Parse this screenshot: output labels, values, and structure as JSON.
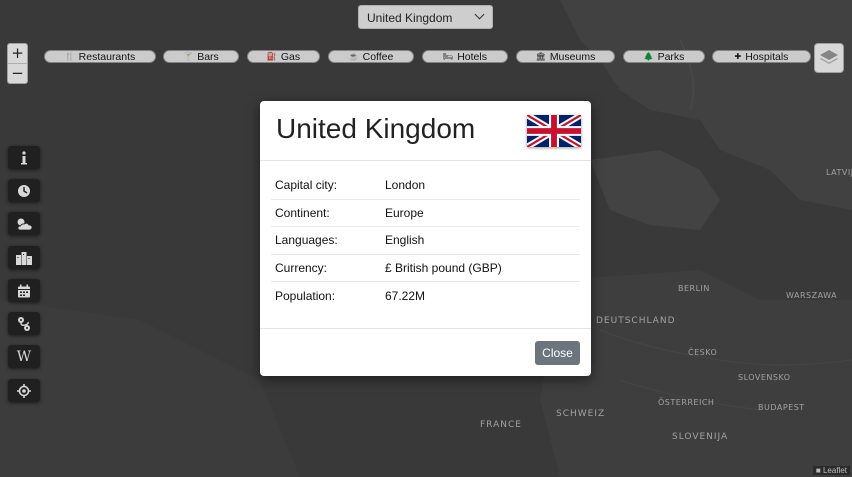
{
  "country_select": {
    "selected": "United Kingdom"
  },
  "zoom": {
    "in": "+",
    "out": "−"
  },
  "categories": [
    {
      "icon": "🍴",
      "label": "Restaurants"
    },
    {
      "icon": "🍸",
      "label": "Bars"
    },
    {
      "icon": "⛽",
      "label": "Gas"
    },
    {
      "icon": "☕",
      "label": "Coffee"
    },
    {
      "icon": "🛏",
      "label": "Hotels"
    },
    {
      "icon": "🏛",
      "label": "Museums"
    },
    {
      "icon": "🌲",
      "label": "Parks"
    },
    {
      "icon": "✚",
      "label": "Hospitals"
    }
  ],
  "map_labels": [
    "BERLIN",
    "WARSZAWA",
    "DEUTSCHLAND",
    "FRANCE",
    "SCHWEIZ",
    "SLOVENSKO",
    "BUDAPEST",
    "ÖSTERREICH",
    "SLOVENIJA",
    "ČESKO",
    "LATVIJA"
  ],
  "modal": {
    "title": "United Kingdom",
    "rows": [
      {
        "key": "Capital city:",
        "value": "London"
      },
      {
        "key": "Continent:",
        "value": "Europe"
      },
      {
        "key": "Languages:",
        "value": "English"
      },
      {
        "key": "Currency:",
        "value": "£ British pound (GBP)"
      },
      {
        "key": "Population:",
        "value": "67.22M"
      }
    ],
    "close_label": "Close"
  },
  "toolbar": [
    "info-icon",
    "clock-icon",
    "weather-icon",
    "city-icon",
    "calendar-icon",
    "route-icon",
    "wikipedia-icon",
    "locate-icon"
  ],
  "attribution": "■ Leaflet",
  "colors": {
    "modal_close_btn": "#6c757d",
    "map_bg": "#3e3e3e",
    "toolbar_bg": "#1f1f1f"
  }
}
